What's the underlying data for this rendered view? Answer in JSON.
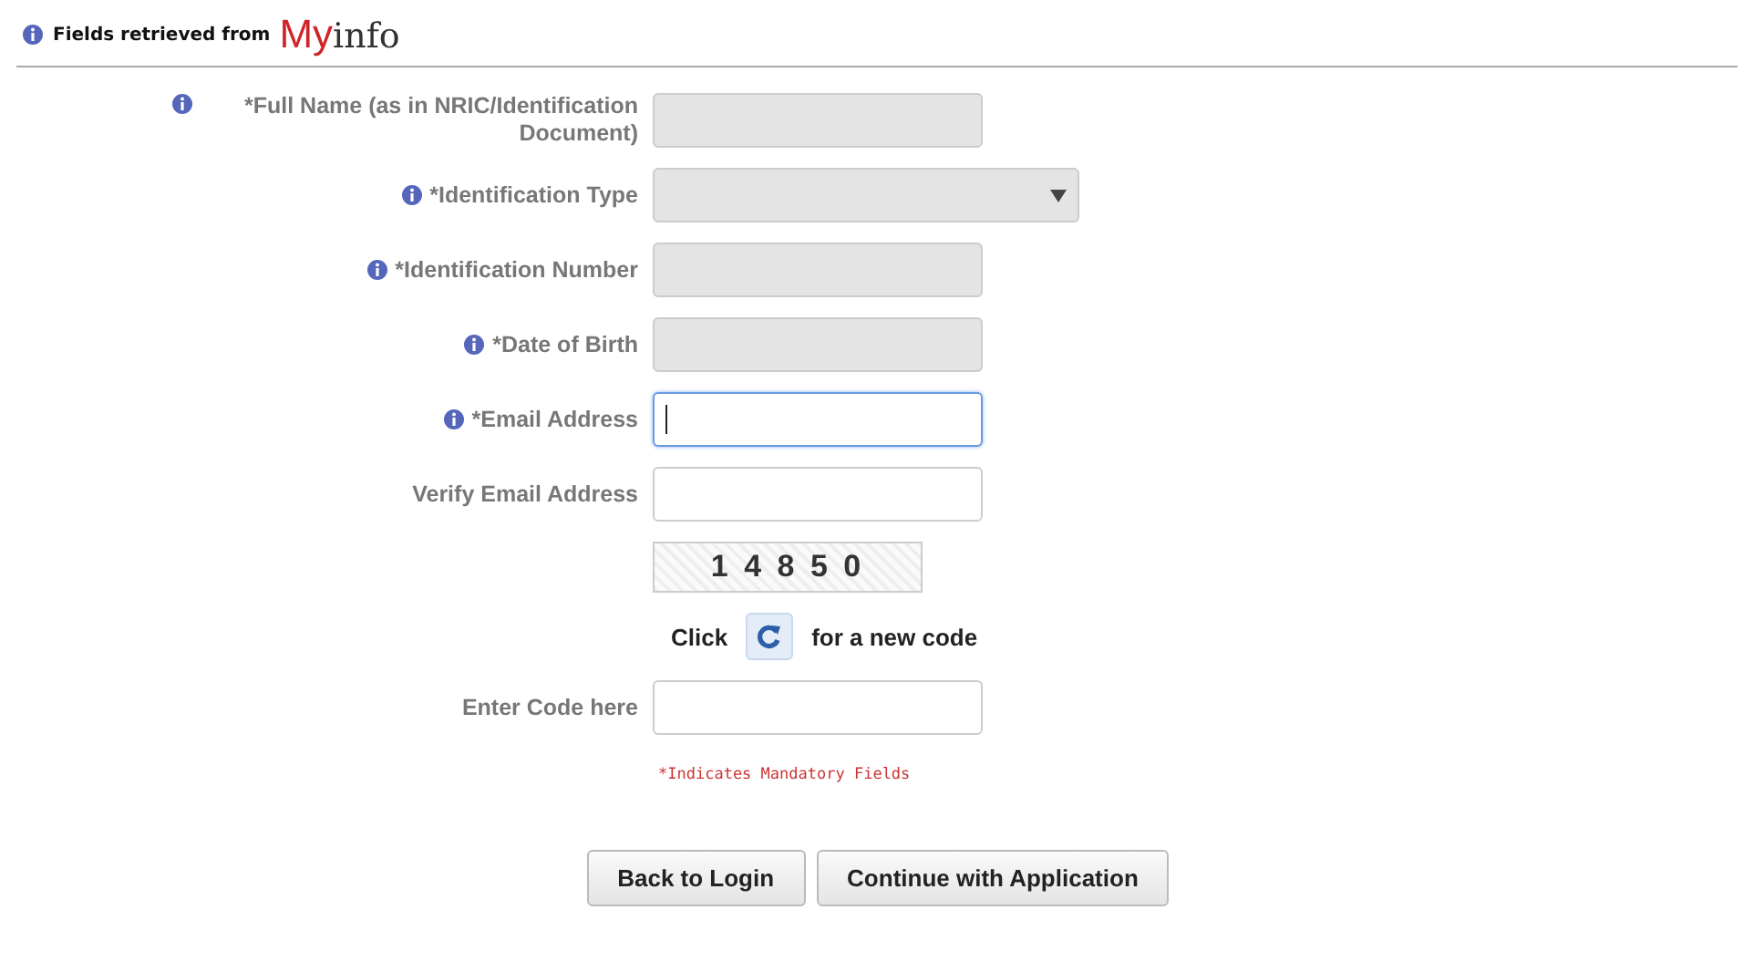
{
  "header": {
    "text": "Fields retrieved from",
    "logo": {
      "part_1": "My",
      "part_2": "info"
    }
  },
  "fields": [
    {
      "kind": "text",
      "label": "*Full Name (as in NRIC/Identification Document)",
      "info": true,
      "disabled": true,
      "focused": false
    },
    {
      "kind": "select",
      "label": "*Identification Type",
      "info": true,
      "disabled": true,
      "focused": false
    },
    {
      "kind": "text",
      "label": "*Identification Number",
      "info": true,
      "disabled": true,
      "focused": false
    },
    {
      "kind": "text",
      "label": "*Date of Birth",
      "info": true,
      "disabled": true,
      "focused": false
    },
    {
      "kind": "text",
      "label": "*Email Address",
      "info": true,
      "disabled": false,
      "focused": true
    },
    {
      "kind": "text",
      "label": "Verify Email Address",
      "info": false,
      "disabled": false,
      "focused": false
    }
  ],
  "captcha": {
    "code": "1 4 8 5 0",
    "refresh_before": "Click",
    "refresh_after": "for a new code"
  },
  "code_field": {
    "label": "Enter Code here"
  },
  "note": "*Indicates Mandatory Fields",
  "buttons": [
    "Back to Login",
    "Continue with Application"
  ]
}
